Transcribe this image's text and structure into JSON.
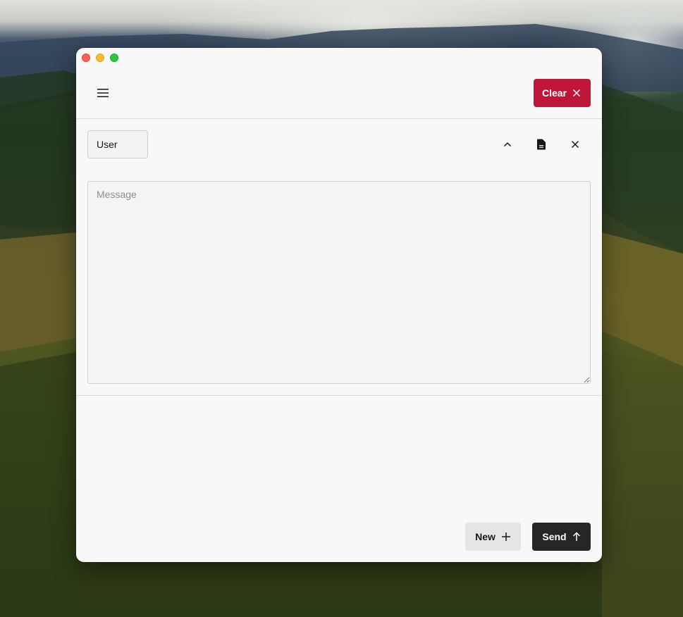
{
  "header": {
    "menu_icon": "hamburger-menu-icon",
    "clear_label": "Clear",
    "clear_icon": "close-icon",
    "clear_color": "#bf1538"
  },
  "message_row": {
    "role_value": "User",
    "collapse_icon": "chevron-up-icon",
    "document_icon": "document-icon",
    "remove_icon": "close-icon",
    "message_placeholder": "Message",
    "message_value": ""
  },
  "footer": {
    "new_label": "New",
    "new_icon": "plus-icon",
    "send_label": "Send",
    "send_icon": "arrow-up-icon",
    "send_color": "#262626"
  }
}
